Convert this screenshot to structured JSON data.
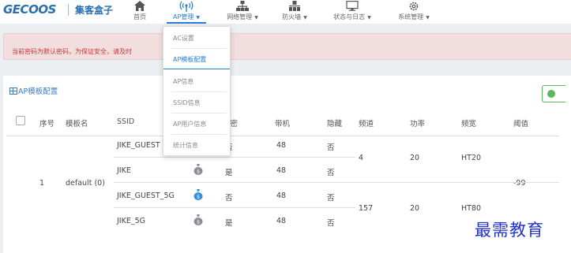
{
  "brand": {
    "logo": "GECOOS",
    "name": "集客盒子"
  },
  "nav": {
    "items": [
      {
        "label": "首页",
        "icon": "home-icon"
      },
      {
        "label": "AP管理",
        "icon": "wireless-ap-icon",
        "active": true
      },
      {
        "label": "网络管理",
        "icon": "network-topology-icon"
      },
      {
        "label": "防火墙",
        "icon": "firewall-icon"
      },
      {
        "label": "状态与日志",
        "icon": "monitor-icon"
      },
      {
        "label": "系统管理",
        "icon": "gear-icon"
      }
    ]
  },
  "alert": {
    "text": "当前密码为默认密码，为保证安全，请及时"
  },
  "panel": {
    "title": "AP模板配置"
  },
  "table": {
    "headers": [
      "序号",
      "模板名",
      "SSID",
      "加密",
      "带机",
      "隐藏",
      "频道",
      "功率",
      "频宽",
      "阈值"
    ],
    "template": {
      "index": "1",
      "name": "default (0)",
      "threshold": "-99"
    },
    "groups": [
      {
        "channel": "4",
        "power": "20",
        "bandwidth": "HT20"
      },
      {
        "channel": "157",
        "power": "20",
        "bandwidth": "HT80"
      }
    ],
    "rows": [
      {
        "ssid": "JIKE_GUEST",
        "encrypt": "否",
        "capacity": "48",
        "hidden": "否",
        "icon_color": "#8a8f96"
      },
      {
        "ssid": "JIKE",
        "encrypt": "是",
        "capacity": "48",
        "hidden": "否",
        "icon_color": "#8a8f96"
      },
      {
        "ssid": "JIKE_GUEST_5G",
        "encrypt": "否",
        "capacity": "48",
        "hidden": "否",
        "icon_color": "#3a8fd9"
      },
      {
        "ssid": "JIKE_5G",
        "encrypt": "是",
        "capacity": "48",
        "hidden": "否",
        "icon_color": "#8a8f96"
      }
    ]
  },
  "dropdown": {
    "items": [
      {
        "label": "AC设置"
      },
      {
        "label": "AP模板配置",
        "active": true
      },
      {
        "label": "AP信息"
      },
      {
        "label": "SSID信息"
      },
      {
        "label": "AP用户信息"
      },
      {
        "label": "统计信息"
      }
    ]
  },
  "watermark": {
    "text": "最需教育"
  }
}
